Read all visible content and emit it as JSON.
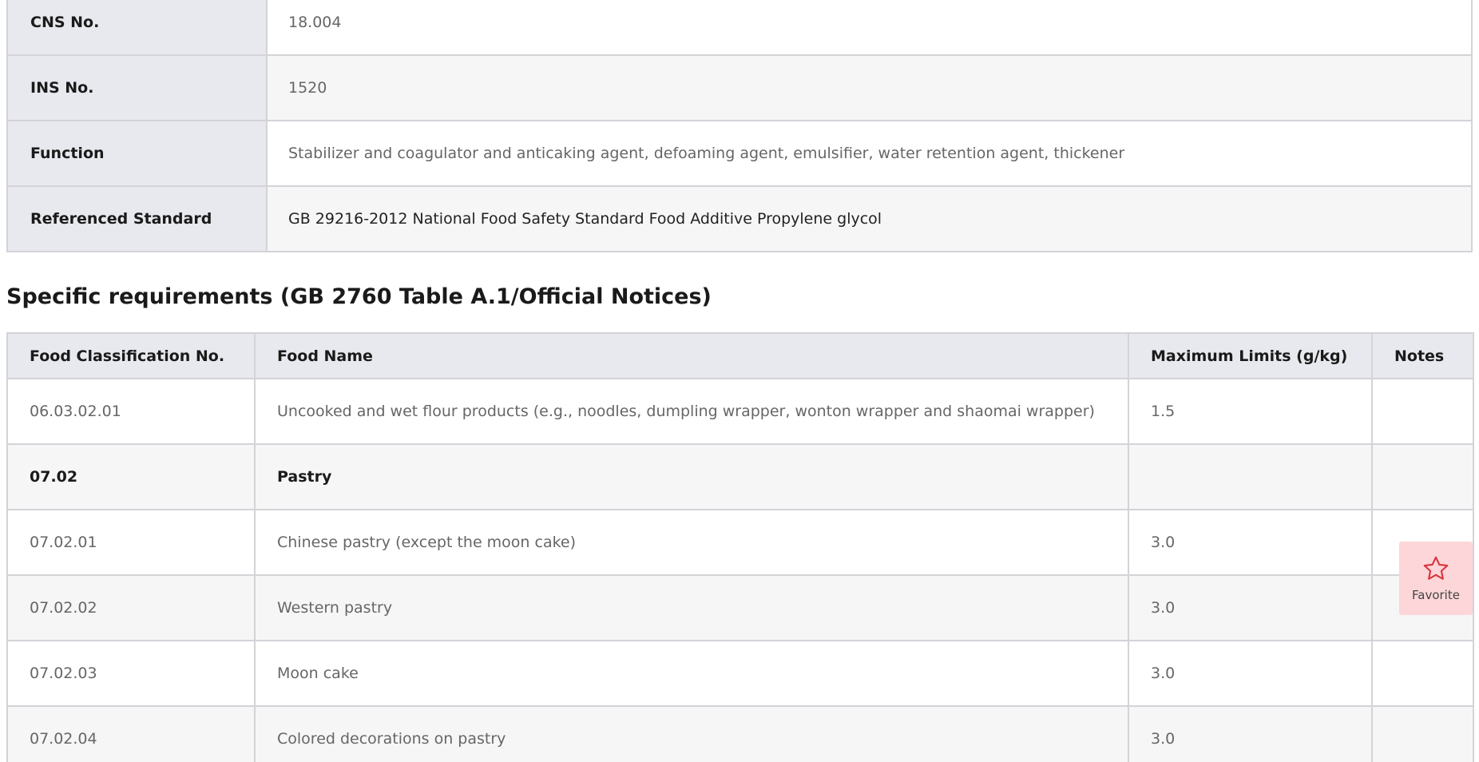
{
  "info": [
    {
      "label": "CNS No.",
      "value": "18.004"
    },
    {
      "label": "INS No.",
      "value": "1520"
    },
    {
      "label": "Function",
      "value": "Stabilizer and coagulator and anticaking agent, defoaming agent, emulsifier, water retention agent, thickener"
    },
    {
      "label": "Referenced Standard",
      "value": "GB 29216-2012 National Food Safety Standard Food Additive Propylene glycol"
    }
  ],
  "section_title": "Specific requirements (GB 2760 Table A.1/Official Notices)",
  "requirements": {
    "headers": [
      "Food Classification No.",
      "Food Name",
      "Maximum Limits (g/kg)",
      "Notes"
    ],
    "rows": [
      {
        "code": "06.03.02.01",
        "name": "Uncooked and wet flour products (e.g., noodles, dumpling wrapper, wonton wrapper and shaomai wrapper)",
        "limit": "1.5",
        "notes": ""
      },
      {
        "code": "07.02",
        "name": "Pastry",
        "limit": "",
        "notes": ""
      },
      {
        "code": "07.02.01",
        "name": "Chinese pastry (except the moon cake)",
        "limit": "3.0",
        "notes": ""
      },
      {
        "code": "07.02.02",
        "name": "Western pastry",
        "limit": "3.0",
        "notes": ""
      },
      {
        "code": "07.02.03",
        "name": "Moon cake",
        "limit": "3.0",
        "notes": ""
      },
      {
        "code": "07.02.04",
        "name": "Colored decorations on pastry",
        "limit": "3.0",
        "notes": ""
      }
    ]
  },
  "favorite": {
    "label": "Favorite",
    "icon": "star-icon",
    "accent": "#d9343f"
  }
}
